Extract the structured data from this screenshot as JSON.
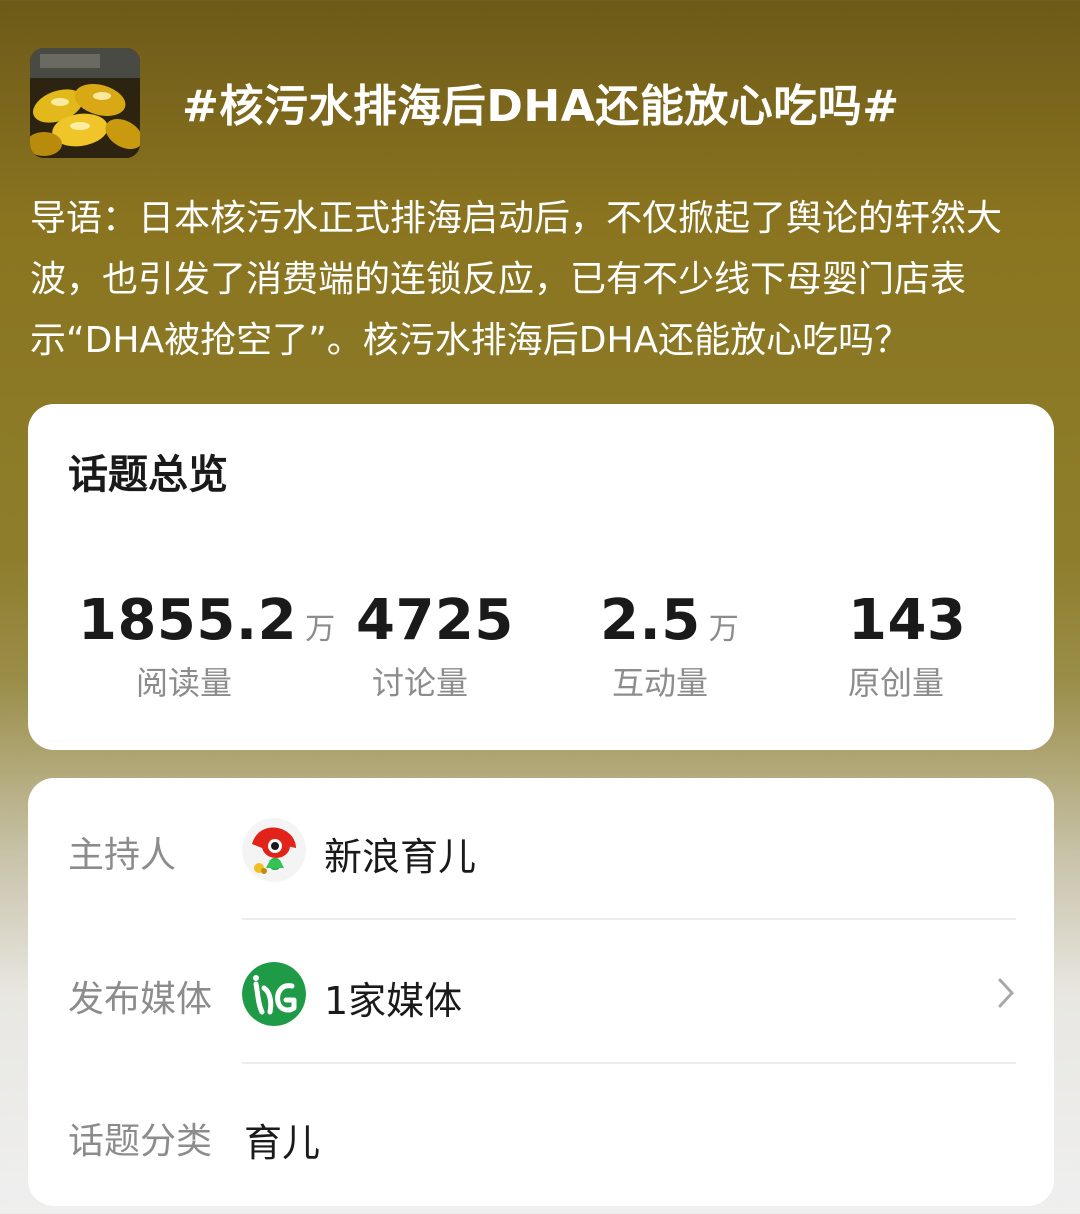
{
  "topic": {
    "title": "#核污水排海后DHA还能放心吃吗#",
    "intro": "导语：日本核污水正式排海启动后，不仅掀起了舆论的轩然大波，也引发了消费端的连锁反应，已有不少线下母婴门店表示“DHA被抢空了”。核污水排海后DHA还能放心吃吗？"
  },
  "overview": {
    "title": "话题总览",
    "stats": [
      {
        "value": "1855.2",
        "unit": "万",
        "label": "阅读量"
      },
      {
        "value": "4725",
        "unit": "",
        "label": "讨论量"
      },
      {
        "value": "2.5",
        "unit": "万",
        "label": "互动量"
      },
      {
        "value": "143",
        "unit": "",
        "label": "原创量"
      }
    ]
  },
  "info": {
    "host": {
      "label": "主持人",
      "value": "新浪育儿",
      "avatar": "sina-logo-icon"
    },
    "media": {
      "label": "发布媒体",
      "value": "1家媒体",
      "avatar": "media-logo-icon"
    },
    "category": {
      "label": "话题分类",
      "value": "育儿"
    }
  },
  "colors": {
    "header_gradient_top": "#6d5a18",
    "header_gradient_mid": "#8e7e2c",
    "page_bottom": "#efefef",
    "card": "#ffffff",
    "text_primary": "#1a1a1a",
    "text_secondary": "#8c8c8c"
  }
}
